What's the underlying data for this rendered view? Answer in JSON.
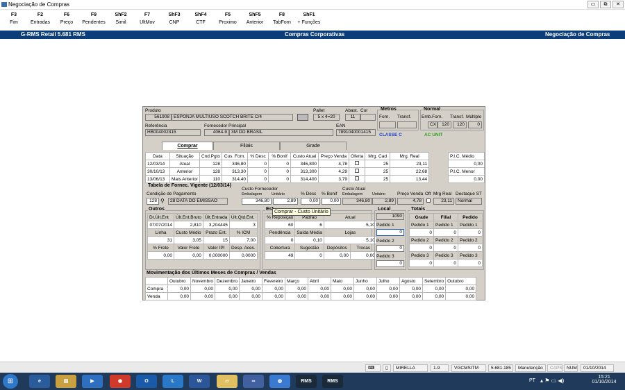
{
  "window": {
    "title": "Negociação de Compras",
    "min": "▭",
    "max": "⧉",
    "close": "✕"
  },
  "fkeys": [
    {
      "key": "F3",
      "label": "Fim"
    },
    {
      "key": "F2",
      "label": "Entradas"
    },
    {
      "key": "F6",
      "label": "Preço"
    },
    {
      "key": "F9",
      "label": "Pendentes"
    },
    {
      "key": "ShF2",
      "label": "Simil"
    },
    {
      "key": "F7",
      "label": "UltMov"
    },
    {
      "key": "ShF3",
      "label": "CNP"
    },
    {
      "key": "ShF4",
      "label": "CTF"
    },
    {
      "key": "F5",
      "label": "Proximo"
    },
    {
      "key": "ShF5",
      "label": "Anterior"
    },
    {
      "key": "F8",
      "label": "TabForn"
    },
    {
      "key": "ShF1",
      "label": "+ Funções"
    }
  ],
  "band": {
    "left": "G-RMS Retail 5.681 RMS",
    "center": "Compras Corporativas",
    "right": "Negociação de Compras"
  },
  "product": {
    "lbl_produto": "Produto",
    "codigo": "561908",
    "descricao": "ESPONJA MULTIUSO SCOTCH BRITE C/4",
    "lbl_pallet": "Pallet",
    "pallet": "5 x 4=20",
    "lbl_abast": "Abast.",
    "abast": "11",
    "lbl_cor": "Cor",
    "cor": "",
    "lbl_referencia": "Referência",
    "referencia": "HB004002315",
    "lbl_fornecedor": "Fornecedor Principal",
    "forn_codigo": "4064-9",
    "forn_nome": "3M DO BRASIL",
    "lbl_ean": "EAN",
    "ean": "7891040001415",
    "lbl_metros": "Metros",
    "lbl_forn": "Forn.",
    "lbl_transf": "Transf.",
    "lbl_normal": "Normal",
    "lbl_emb_forn": "Emb.Forn.",
    "lbl_transf2": "Transf.",
    "lbl_multiplo": "Múltiplo",
    "emb_un": "CX",
    "emb_forn": "120",
    "transf_val": "120",
    "multiplo": "0",
    "classe": "CLASSE C",
    "ac_unit": "AC UNIT"
  },
  "tabs": [
    "Comprar",
    "Filiais",
    "Grade"
  ],
  "hist": {
    "headers": [
      "Data",
      "Situação",
      "Cnd.Pgto",
      "Cus. Forn.",
      "% Desc",
      "% Bonif",
      "Custo Atual",
      "Preço Venda",
      "Oferta",
      "Mrg. Cad",
      "Mrg. Real"
    ],
    "rows": [
      [
        "12/03/14",
        "Atual",
        "128",
        "346,80",
        "0",
        "0",
        "346,800",
        "4,78",
        "",
        "25",
        "23,11"
      ],
      [
        "30/10/13",
        "Anterior",
        "128",
        "313,30",
        "0",
        "0",
        "313,300",
        "4,29",
        "",
        "25",
        "22,68"
      ],
      [
        "13/06/13",
        "Mais Anterior",
        "110",
        "314,40",
        "0",
        "0",
        "314,400",
        "3,79",
        "",
        "25",
        "13,44"
      ]
    ],
    "pic_medio_lbl": "P.I.C. Médio",
    "pic_medio": "0,00",
    "pic_menor_lbl": "P.I.C. Menor",
    "pic_menor": "0,00"
  },
  "tabela": {
    "title": "Tabela de Fornec. Vigente (12/03/14)",
    "lbl_cond": "Condição de Pagamento",
    "cond": "128",
    "cond_desc": "28 DATA DO EMISSAO",
    "lbl_custo_forn": "Custo Fornecedor",
    "lbl_embalagem": "Embalagem",
    "lbl_unitario": "Unitário",
    "emb": "346,80",
    "unit": "2,89",
    "lbl_desc": "% Desc",
    "desc": "0,00",
    "lbl_bonif": "% Bonif",
    "bonif": "0,00",
    "lbl_custo_atual": "Custo Atual",
    "lbl_embalagem2": "Embalagem",
    "lbl_unitario2": "Unitário",
    "ca_emb": "346,80",
    "ca_unit": "2,89",
    "lbl_preco_venda": "Preço Venda",
    "preco_venda": "4,78",
    "lbl_oft": "Oft",
    "lbl_mrg_real": "Mrg Real",
    "mrg_real": "23,11",
    "lbl_destaque": "Destaque ST",
    "destaque": "Normal"
  },
  "outros": {
    "title": "Outros",
    "rows": [
      [
        "Dt.Últ.Ent",
        "Últ.Ent.Bruto",
        "Últ.Entrada",
        "Últ.Qtd.Ent."
      ],
      [
        "07/07/2014",
        "2,810",
        "3,204445",
        "3"
      ],
      [
        "Linha",
        "Custo Médio",
        "Prazo Ent.",
        "% ICM"
      ],
      [
        "31",
        "3,05",
        "15",
        "7,00"
      ],
      [
        "% Frete",
        "Valor Frete",
        "Valor IPI",
        "Desp. Aces."
      ],
      [
        "0,00",
        "0,00",
        "0,000000",
        "0,0000"
      ]
    ]
  },
  "estoque": {
    "title": "Est",
    "rows": [
      [
        "% Reposição",
        "Padrão",
        "Atual"
      ],
      [
        "60",
        "6",
        "5,10"
      ],
      [
        "Pendência",
        "Saída Média",
        "Lojas"
      ],
      [
        "0",
        "0,10",
        "5,10"
      ],
      [
        "Cobertura",
        "Sugestão",
        "Depósitos",
        "Trocas"
      ],
      [
        "49",
        "0",
        "0,00",
        "0,00"
      ]
    ]
  },
  "local": {
    "title": "Local",
    "loja": "1090",
    "p1": "Pedido 1",
    "p2": "Pedido 2",
    "p3": "Pedido 3",
    "v1": "0",
    "v2": "0",
    "v3": "0"
  },
  "totais": {
    "title": "Totais",
    "headers": [
      "Grade",
      "Filial",
      "Pedido"
    ],
    "rows": [
      [
        "Pedido 1",
        "Pedido 1",
        "Pedido 1"
      ],
      [
        "0",
        "0",
        "0"
      ],
      [
        "Pedido 2",
        "Pedido 2",
        "Pedido 2"
      ],
      [
        "0",
        "0",
        "0"
      ],
      [
        "Pedido 3",
        "Pedido 3",
        "Pedido 3"
      ],
      [
        "0",
        "0",
        "0"
      ]
    ]
  },
  "movimentacao": {
    "title": "Movimentação dos Últimos Meses de Compras / Vendas",
    "months": [
      "Outubro",
      "Novembro",
      "Dezembro",
      "Janeiro",
      "Fevereiro",
      "Março",
      "Abril",
      "Maio",
      "Junho",
      "Julho",
      "Agosto",
      "Setembro",
      "Outubro"
    ],
    "rows": [
      {
        "label": "Compra",
        "values": [
          "0,00",
          "0,00",
          "0,00",
          "0,00",
          "0,00",
          "0,00",
          "0,00",
          "0,00",
          "0,00",
          "0,00",
          "0,00",
          "0,00",
          "0,00"
        ]
      },
      {
        "label": "Venda",
        "values": [
          "0,00",
          "0,00",
          "0,00",
          "0,00",
          "0,00",
          "0,00",
          "0,00",
          "0,00",
          "0,00",
          "0,00",
          "0,00",
          "0,00",
          "0,00"
        ]
      }
    ]
  },
  "tooltip": "Comprar - Custo Unitário",
  "statusbar": {
    "user": "MIRELLA",
    "page": "1-9",
    "server": "VGCMSITM",
    "version": "5.681.185",
    "mode": "Manutenção",
    "caps": "CAPS",
    "num": "NUM",
    "date": "01/10/2014"
  },
  "taskbar": {
    "lang": "PT",
    "time": "15:21",
    "date": "01/10/2014",
    "rms1": "RMS",
    "rms2": "RMS"
  }
}
